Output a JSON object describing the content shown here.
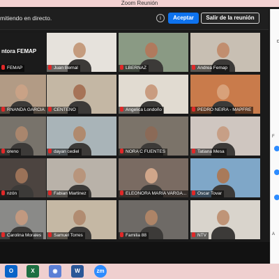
{
  "window": {
    "title": "Zoom Reunión"
  },
  "notice": {
    "message": "mitiendo en directo.",
    "info_glyph": "i",
    "accept_label": "Aceptar",
    "leave_label": "Salir de la reunión"
  },
  "participants": [
    {
      "name": "ntora FEMAP",
      "label": "FEMAP"
    },
    {
      "name": "Juan Bernal",
      "label": "Juan Bernal"
    },
    {
      "name": "LBERNAZ",
      "label": "LBERNAZ"
    },
    {
      "name": "Andrea Femap",
      "label": "Andrea Femap"
    },
    {
      "name": "RNANDA GARCIA",
      "label": "RNANDA GARCIA ..."
    },
    {
      "name": "CENTENO",
      "label": "CENTENO"
    },
    {
      "name": "Angelica Londoño",
      "label": "Angelica Londoño"
    },
    {
      "name": "PEDRO NEIRA - MAPFRE",
      "label": "PEDRO NEIRA - MAPFRE"
    },
    {
      "name": "oreno",
      "label": "oreno"
    },
    {
      "name": "dayan cediel",
      "label": "dayan cediel"
    },
    {
      "name": "NORA C FUENTES",
      "label": "NORA C FUENTES"
    },
    {
      "name": "Tatiana Mesa",
      "label": "Tatiana Mesa"
    },
    {
      "name": "nzón",
      "label": "nzón"
    },
    {
      "name": "Fabian Martinez",
      "label": "Fabian Martinez"
    },
    {
      "name": "ELEONORA MARIA VARGA",
      "label": "ELEONORA MARIA VARGA..."
    },
    {
      "name": "Oscar Tovar",
      "label": "Oscar Tovar"
    },
    {
      "name": "Carolina Morales",
      "label": "Carolina Morales"
    },
    {
      "name": "Samuel Torres",
      "label": "Samuel Torres"
    },
    {
      "name": "Familia 88",
      "label": "Familia 88"
    },
    {
      "name": "NTV",
      "label": "NTV"
    }
  ],
  "right_panel": {
    "partial_text_1": "F",
    "partial_text_2": "A"
  },
  "taskbar": {
    "apps": [
      {
        "name": "outlook",
        "glyph": "O",
        "color": "#0a64c8"
      },
      {
        "name": "excel",
        "glyph": "X",
        "color": "#1d6f42"
      },
      {
        "name": "chrome",
        "glyph": "◉",
        "color": "#5b7fd6"
      },
      {
        "name": "word",
        "glyph": "W",
        "color": "#2b5797"
      },
      {
        "name": "zoom",
        "glyph": "zm",
        "color": "#2d8cff"
      }
    ]
  },
  "colors": {
    "accept": "#0e72ed",
    "mic_muted": "#e02828",
    "taskbar": "#efcfcf"
  }
}
